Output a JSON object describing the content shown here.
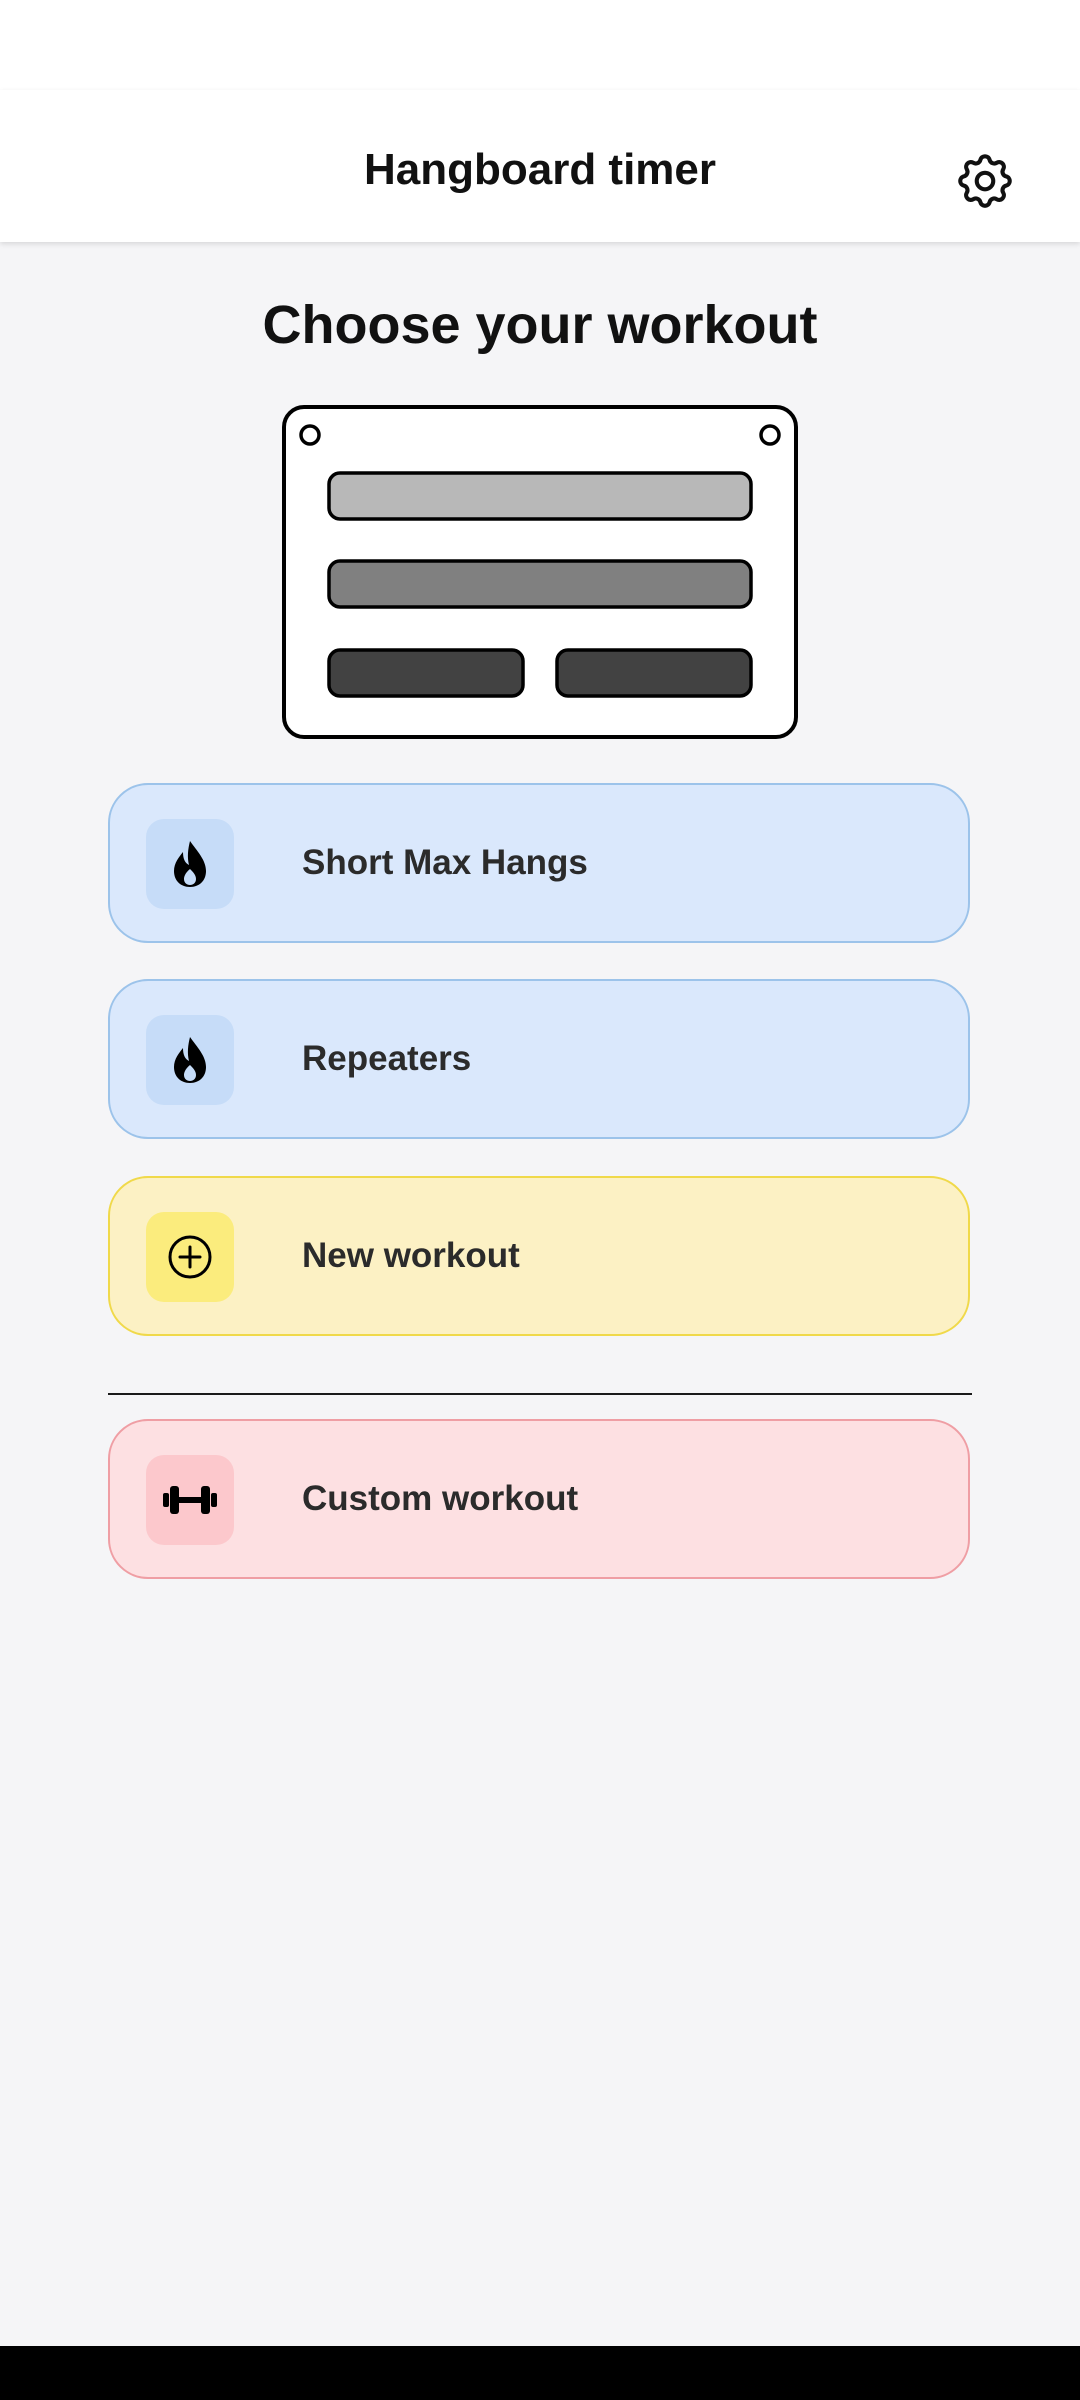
{
  "app_bar": {
    "title": "Hangboard timer",
    "settings_icon": "gear-icon"
  },
  "main": {
    "headline": "Choose your workout",
    "illustration": "hangboard-illustration",
    "workouts": [
      {
        "label": "Short Max Hangs",
        "icon": "flame-icon",
        "accent": "#dae8fc"
      },
      {
        "label": "Repeaters",
        "icon": "flame-icon",
        "accent": "#dae8fc"
      },
      {
        "label": "New workout",
        "icon": "add-circle-icon",
        "accent": "#fcf1c4"
      }
    ],
    "custom": {
      "label": "Custom workout",
      "icon": "dumbbell-icon",
      "accent": "#fde0e2"
    }
  }
}
